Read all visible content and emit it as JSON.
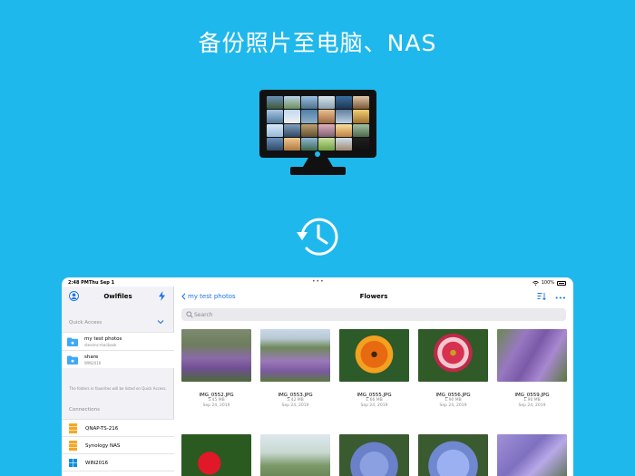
{
  "headline": "备份照片至电脑、NAS",
  "colors": {
    "background": "#1fb8ec",
    "accent": "#1a73e8",
    "monitor": "#111111"
  },
  "status_bar": {
    "time": "2:48 PM",
    "day": "Thu Sep 1",
    "battery": "100%"
  },
  "sidebar": {
    "title": "Owlfiles",
    "quick_access_label": "Quick Access",
    "quick_access": [
      {
        "name": "my test photos",
        "sub": "stevens-macbook"
      },
      {
        "name": "share",
        "sub": "WIN2016"
      }
    ],
    "note": "The folders in favorites will be listed on Quick Access.",
    "connections_label": "Connections",
    "connections": [
      {
        "name": "QNAP-TS-216",
        "icon": "nas-icon"
      },
      {
        "name": "Synology NAS",
        "icon": "nas-icon"
      },
      {
        "name": "WIN2016",
        "icon": "windows-icon"
      }
    ]
  },
  "main": {
    "back_label": "my test photos",
    "title": "Flowers",
    "search_placeholder": "Search",
    "files": [
      {
        "name": "IMG_0552.JPG",
        "size": "5.45 MB",
        "date": "Sep 24, 2019"
      },
      {
        "name": "IMG_0553.JPG",
        "size": "5.42 MB",
        "date": "Sep 24, 2019"
      },
      {
        "name": "IMG_0555.JPG",
        "size": "1.66 MB",
        "date": "Sep 24, 2019"
      },
      {
        "name": "IMG_0556.JPG",
        "size": "1.90 MB",
        "date": "Sep 24, 2019"
      },
      {
        "name": "IMG_0559.JPG",
        "size": "1.90 MB",
        "date": "Sep 24, 2019"
      }
    ]
  }
}
